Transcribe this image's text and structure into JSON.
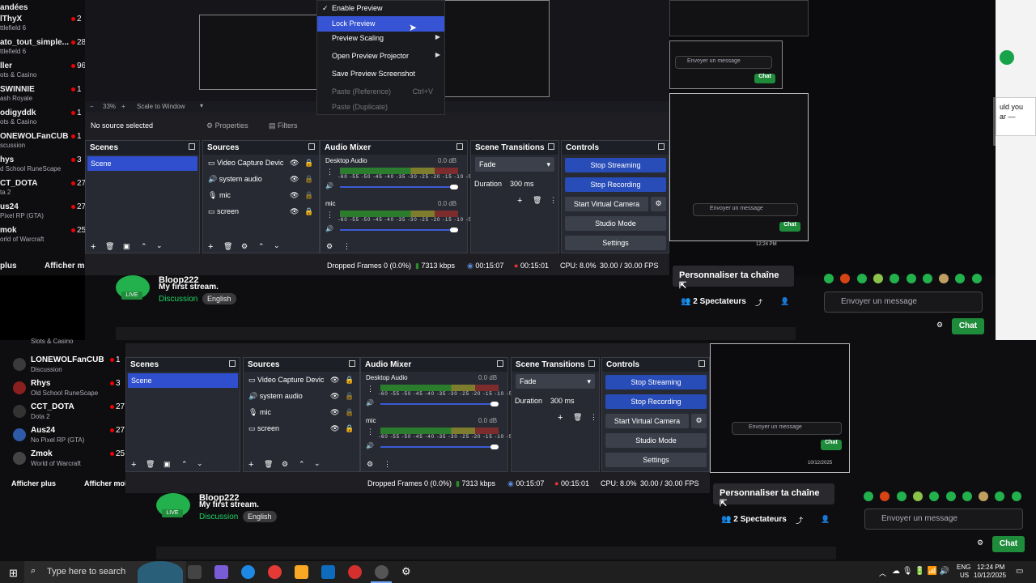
{
  "top_left_header": "andées",
  "following": [
    {
      "name": "lThyX",
      "sub": "ttlefield 6",
      "count": "2"
    },
    {
      "name": "ato_tout_simple...",
      "sub": "ttlefield 6",
      "count": "28"
    },
    {
      "name": "ller",
      "sub": "ots & Casino",
      "count": "96"
    },
    {
      "name": "SWINNIE",
      "sub": "ash Royale",
      "count": "1"
    },
    {
      "name": "odigyddk",
      "sub": "ots & Casino",
      "count": "1"
    },
    {
      "name": "ONEWOLFanCUB",
      "sub": "scussion",
      "count": "1"
    },
    {
      "name": "hys",
      "sub": "d School RuneScape",
      "count": "3"
    },
    {
      "name": "CT_DOTA",
      "sub": "ta 2",
      "count": "27"
    },
    {
      "name": "us24",
      "sub": "Pixel RP (GTA)",
      "count": "27"
    },
    {
      "name": "mok",
      "sub": "orld of Warcraft",
      "count": "25"
    }
  ],
  "left_footer": {
    "more": "plus",
    "show": "Afficher moi"
  },
  "context_menu": {
    "items": [
      {
        "label": "Enable Preview",
        "check": "✓",
        "state": ""
      },
      {
        "label": "Lock Preview",
        "check": "",
        "state": "sel"
      },
      {
        "label": "Preview Scaling",
        "check": "",
        "state": "",
        "arrow": "▶"
      },
      {
        "label": "Open Preview Projector",
        "check": "",
        "state": "",
        "arrow": "▶"
      },
      {
        "label": "Save Preview Screenshot",
        "check": "",
        "state": ""
      },
      {
        "label": "Paste (Reference)",
        "check": "",
        "state": "dis",
        "shortcut": "Ctrl+V"
      },
      {
        "label": "Paste (Duplicate)",
        "check": "",
        "state": "dis"
      }
    ]
  },
  "obs_top": {
    "zoom": "33%",
    "scale": "Scale to Window",
    "no_source": "No source selected",
    "properties": "Properties",
    "filters": "Filters"
  },
  "obs": {
    "scenes_title": "Scenes",
    "scene": "Scene",
    "sources_title": "Sources",
    "sources": [
      "Video Capture Devic",
      "system audio",
      "mic",
      "screen"
    ],
    "mixer_title": "Audio Mixer",
    "track1": "Desktop Audio",
    "track2": "mic",
    "db": "0.0 dB",
    "ticks": "-60 -55 -50 -45 -40 -35 -30 -25 -20 -15 -10 -5 0",
    "transitions_title": "Scene Transitions",
    "fade": "Fade",
    "duration_label": "Duration",
    "duration": "300 ms",
    "controls_title": "Controls",
    "stop_streaming": "Stop Streaming",
    "stop_recording": "Stop Recording",
    "virtual_cam": "Start Virtual Camera",
    "studio_mode": "Studio Mode",
    "settings": "Settings"
  },
  "status": {
    "dropped": "Dropped Frames 0 (0.0%)",
    "kbps": "7313 kbps",
    "live_time": "00:15:07",
    "rec_time": "00:15:01",
    "cpu": "CPU: 8.0%",
    "fps": "30.00 / 30.00 FPS"
  },
  "channel": {
    "name": "Bloop222",
    "title": "My first stream.",
    "category": "Discussion",
    "tag": "English",
    "live": "LIVE",
    "customize": "Personnaliser ta chaîne",
    "viewers_count": "2",
    "viewers_label": "Spectateurs",
    "chat_placeholder": "Envoyer un message",
    "chat_button": "Chat"
  },
  "right_snippet": [
    "uld you",
    "ar —"
  ],
  "bottom_list": [
    {
      "name": "Slots & Casino",
      "sub": "",
      "count": ""
    },
    {
      "name": "LONEWOLFanCUB",
      "sub": "Discussion",
      "count": "1"
    },
    {
      "name": "Rhys",
      "sub": "Old School RuneScape",
      "count": "3"
    },
    {
      "name": "CCT_DOTA",
      "sub": "Dota 2",
      "count": "27"
    },
    {
      "name": "Aus24",
      "sub": "No Pixel RP (GTA)",
      "count": "27"
    },
    {
      "name": "Zmok",
      "sub": "World of Warcraft",
      "count": "25"
    }
  ],
  "bottom_footer": {
    "more": "Afficher plus",
    "show": "Afficher moi"
  },
  "taskbar": {
    "search": "Type here to search",
    "lang1": "ENG",
    "lang2": "US",
    "time": "12:24 PM",
    "date": "10/12/2025"
  },
  "mini_clock": {
    "time": "12:24 PM",
    "date": "10/12/2025",
    "lang": "ENG US"
  }
}
